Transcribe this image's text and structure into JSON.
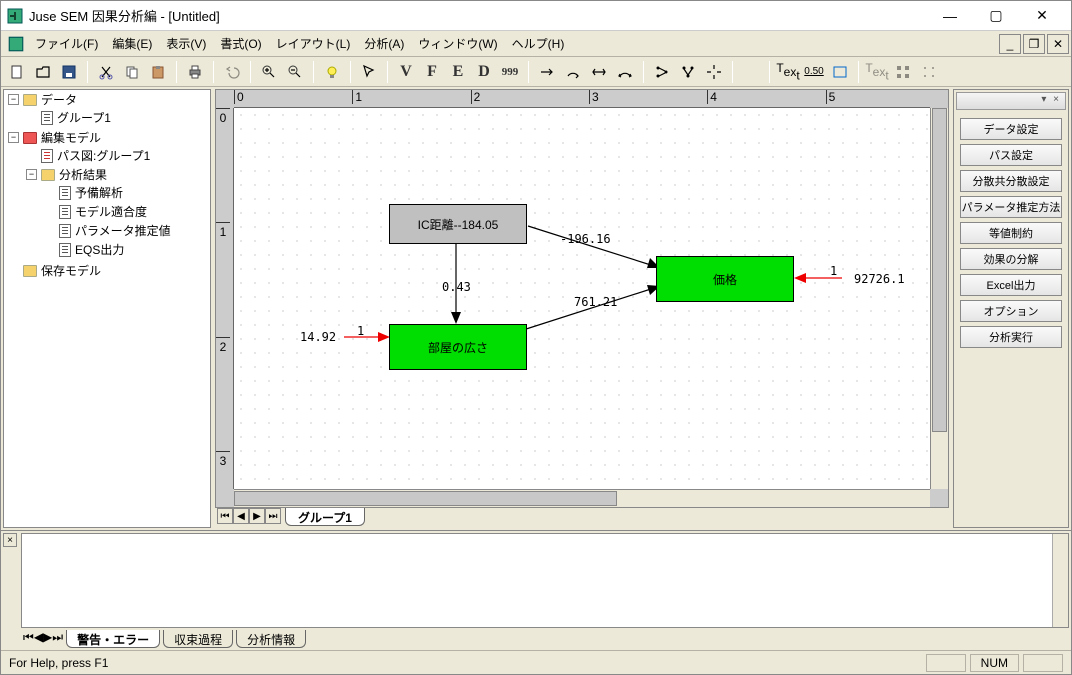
{
  "window": {
    "title": "Juse SEM 因果分析編 - [Untitled]"
  },
  "menu": {
    "file": "ファイル(F)",
    "edit": "編集(E)",
    "view": "表示(V)",
    "format": "書式(O)",
    "layout": "レイアウト(L)",
    "analyze": "分析(A)",
    "window": "ウィンドウ(W)",
    "help": "ヘルプ(H)"
  },
  "tree": {
    "data": "データ",
    "group1": "グループ1",
    "editmodel": "編集モデル",
    "pathdiag": "パス図:グループ1",
    "results": "分析結果",
    "prelim": "予備解析",
    "fit": "モデル適合度",
    "param": "パラメータ推定値",
    "eqs": "EQS出力",
    "saved": "保存モデル"
  },
  "diagram": {
    "box_ic": "IC距離--184.05",
    "box_room": "部屋の広さ",
    "box_price": "価格",
    "v_043": "0.43",
    "v_neg196": "-196.16",
    "v_761": "761.21",
    "v_1492": "14.92",
    "v_1a": "1",
    "v_92726": "92726.1",
    "v_1b": "1"
  },
  "sheetTab": "グループ1",
  "ruler": {
    "t0": "0",
    "t1": "1",
    "t2": "2",
    "t3": "3",
    "t4": "4",
    "t5": "5",
    "v0": "0",
    "v1": "1",
    "v2": "2",
    "v3": "3"
  },
  "rightpanel": {
    "b1": "データ設定",
    "b2": "パス設定",
    "b3": "分散共分散設定",
    "b4": "パラメータ推定方法",
    "b5": "等値制約",
    "b6": "効果の分解",
    "b7": "Excel出力",
    "b8": "オプション",
    "b9": "分析実行"
  },
  "bottomTabs": {
    "t1": "警告・エラー",
    "t2": "収束過程",
    "t3": "分析情報"
  },
  "statusbar": {
    "help": "For Help, press F1",
    "num": "NUM"
  }
}
